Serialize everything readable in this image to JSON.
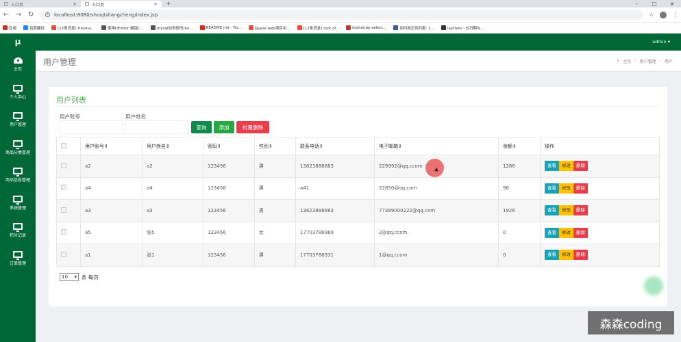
{
  "browser": {
    "tabs": [
      {
        "label": "入口页",
        "active": false
      },
      {
        "label": "入口页",
        "active": true
      }
    ],
    "new_tab": "+",
    "url": "localhost:8080/shoujishangcheng/index.jsp",
    "bookmarks": [
      {
        "label": "应用",
        "color": "#c0392b"
      },
      {
        "label": "百度翻译",
        "color": "#2e86de"
      },
      {
        "label": "(12条消息) fresma...",
        "color": "#e74c3c"
      },
      {
        "label": "使用UEditor 报错C...",
        "color": "#555555"
      },
      {
        "label": "mysql如何修改roo...",
        "color": "#555555"
      },
      {
        "label": "README.md · Tor...",
        "color": "#d62c1a"
      },
      {
        "label": "在java web项目中...",
        "color": "#e74c3c"
      },
      {
        "label": "(12条消息) root of...",
        "color": "#e74c3c"
      },
      {
        "label": "bootstrap-select...",
        "color": "#c0392b"
      },
      {
        "label": "如何用正则匹配: 2...",
        "color": "#3b5998"
      },
      {
        "label": "layDate - JS日期与...",
        "color": "#333333"
      }
    ]
  },
  "app": {
    "logo": "μ",
    "user": "admin ▾",
    "sidebar": [
      {
        "label": "主页",
        "icon": "dashboard-icon"
      },
      {
        "label": "个人中心",
        "icon": "monitor-icon"
      },
      {
        "label": "用户管理",
        "icon": "monitor-icon"
      },
      {
        "label": "商品分类管理",
        "icon": "monitor-icon"
      },
      {
        "label": "商品信息管理",
        "icon": "monitor-icon"
      },
      {
        "label": "系统管理",
        "icon": "monitor-icon"
      },
      {
        "label": "积分记录",
        "icon": "monitor-icon"
      },
      {
        "label": "订单管理",
        "icon": "monitor-icon"
      }
    ],
    "page_title": "用户管理",
    "breadcrumb": [
      "主页",
      "用户管理",
      "用户"
    ],
    "card_title": "用户列表",
    "filters": {
      "account_label": "用户账号",
      "name_label": "用户姓名",
      "account_value": "",
      "name_value": ""
    },
    "buttons": {
      "query": "查询",
      "add": "添加",
      "batch_delete": "批量删除"
    },
    "colors": {
      "primary": "#006837",
      "query": "#0f8a4c",
      "add": "#28a745",
      "batch_delete": "#e83e4c"
    },
    "table": {
      "headers": [
        "用户账号⇕",
        "用户姓名⇕",
        "密码⇕",
        "性别⇕",
        "联系电话⇕",
        "电子邮箱⇕",
        "余额⇕",
        "操作"
      ],
      "rows": [
        [
          "a2",
          "a2",
          "123456",
          "男",
          "13823888883",
          "229992@qq.ccom",
          "1286"
        ],
        [
          "a4",
          "a4",
          "123456",
          "男",
          "a41",
          "22850@qq.com",
          "98"
        ],
        [
          "a3",
          "a3",
          "123456",
          "男",
          "13823888883",
          "77389000222@qq.com",
          "1926"
        ],
        [
          "a5",
          "张5",
          "123456",
          "女",
          "17703786969",
          "2@qq.ccom",
          "0"
        ],
        [
          "a1",
          "张1",
          "123456",
          "男",
          "17703786931",
          "1@qq.ccom",
          "0"
        ]
      ],
      "row_actions": [
        "查看",
        "修改",
        "删除"
      ]
    },
    "pager": {
      "page_size": "10",
      "suffix": "条 每页"
    }
  },
  "watermark": "森森coding"
}
